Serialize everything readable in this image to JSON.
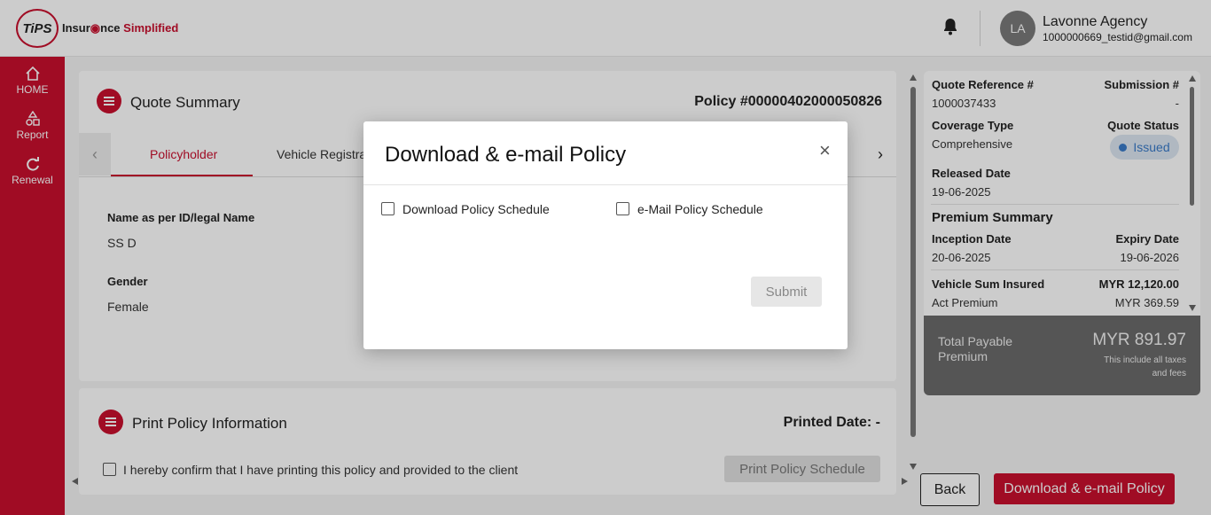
{
  "header": {
    "logo_mark": "TiPS",
    "logo_text_a": "Insur",
    "logo_text_b": "nce",
    "logo_text_c": "Simplified",
    "avatar_initials": "LA",
    "agency_name": "Lavonne Agency",
    "user_email": "1000000669_testid@gmail.com",
    "bell_icon": "bell-icon"
  },
  "sidebar": {
    "items": [
      {
        "label": "HOME",
        "icon": "home-icon"
      },
      {
        "label": "Report",
        "icon": "shapes-icon"
      },
      {
        "label": "Renewal",
        "icon": "refresh-icon"
      }
    ]
  },
  "quote_summary": {
    "title": "Quote Summary",
    "policy_number": "Policy #00000402000050826",
    "tabs": [
      "Policyholder",
      "Vehicle Registrat"
    ],
    "fields": [
      {
        "label": "Name as per ID/legal Name",
        "value": "SS D"
      },
      {
        "label": "Gender",
        "value": "Female"
      }
    ]
  },
  "print_info": {
    "title": "Print Policy Information",
    "printed_date": "Printed Date: -",
    "confirm_text": "I hereby confirm that I have printing this policy and provided to the client",
    "print_button": "Print Policy Schedule"
  },
  "right_panel": {
    "quote_ref_label": "Quote Reference #",
    "quote_ref_value": "1000037433",
    "submission_label": "Submission #",
    "submission_value": "-",
    "coverage_label": "Coverage Type",
    "coverage_value": "Comprehensive",
    "quote_status_label": "Quote Status",
    "quote_status_value": "Issued",
    "released_label": "Released Date",
    "released_value": "19-06-2025",
    "premium_summary_title": "Premium Summary",
    "inception_label": "Inception Date",
    "inception_value": "20-06-2025",
    "expiry_label": "Expiry Date",
    "expiry_value": "19-06-2026",
    "sum_insured_label": "Vehicle Sum Insured",
    "sum_insured_value": "MYR 12,120.00",
    "act_premium_label": "Act Premium",
    "act_premium_value": "MYR 369.59",
    "total_label_1": "Total Payable",
    "total_label_2": "Premium",
    "total_value": "MYR 891.97",
    "total_note_1": "This include all taxes",
    "total_note_2": "and fees"
  },
  "footer": {
    "back_button": "Back",
    "download_button": "Download & e-mail Policy"
  },
  "modal": {
    "title": "Download & e-mail Policy",
    "close_symbol": "×",
    "option_download": "Download Policy Schedule",
    "option_email": "e-Mail Policy Schedule",
    "submit_button": "Submit"
  },
  "colors": {
    "brand_red": "#c8102e",
    "status_blue": "#3a7bc8",
    "total_bg": "#6b6b6b"
  }
}
